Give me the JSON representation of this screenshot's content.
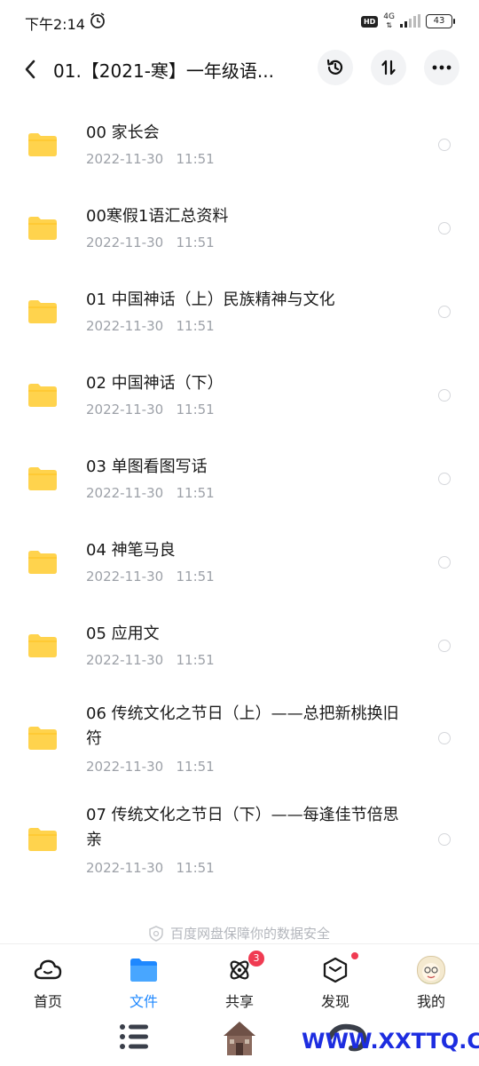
{
  "status": {
    "time": "下午2:14",
    "hd": "HD",
    "network": "4G",
    "battery": "43"
  },
  "header": {
    "title": "01.【2021-寒】一年级语..."
  },
  "files": [
    {
      "name": "00 家长会",
      "date": "2022-11-30   11:51"
    },
    {
      "name": "00寒假1语汇总资料",
      "date": "2022-11-30   11:51"
    },
    {
      "name": "01 中国神话（上）民族精神与文化",
      "date": "2022-11-30   11:51"
    },
    {
      "name": "02 中国神话（下）",
      "date": "2022-11-30   11:51"
    },
    {
      "name": "03 单图看图写话",
      "date": "2022-11-30   11:51"
    },
    {
      "name": "04 神笔马良",
      "date": "2022-11-30   11:51"
    },
    {
      "name": "05 应用文",
      "date": "2022-11-30   11:51"
    },
    {
      "name": "06 传统文化之节日（上）——总把新桃换旧符",
      "date": "2022-11-30   11:51"
    },
    {
      "name": "07 传统文化之节日（下）——每逢佳节倍思亲",
      "date": "2022-11-30   11:51"
    }
  ],
  "footer_notice": "百度网盘保障你的数据安全",
  "tabs": [
    {
      "label": "首页"
    },
    {
      "label": "文件"
    },
    {
      "label": "共享",
      "badge": "3"
    },
    {
      "label": "发现"
    },
    {
      "label": "我的"
    }
  ],
  "watermark": "WWW.XXTTQ.COM",
  "colors": {
    "accent": "#1e88ff",
    "folder": "#ffd34d",
    "badge": "#f03b52",
    "date": "#9da1a8",
    "watermark": "#1d2de0"
  }
}
